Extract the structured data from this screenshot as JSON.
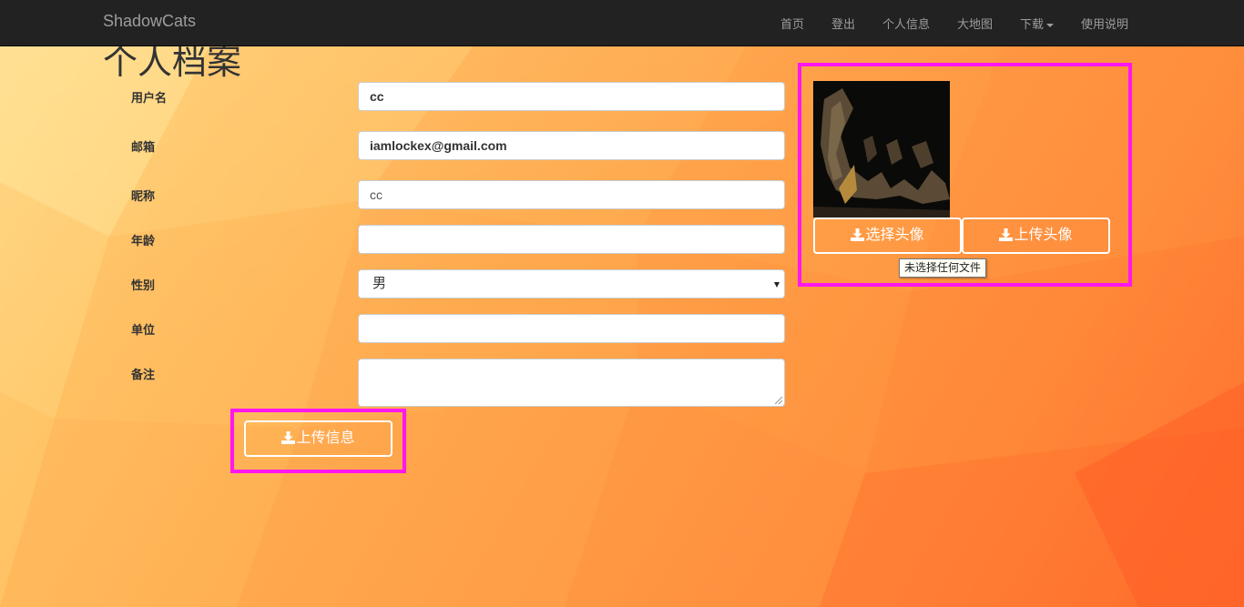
{
  "navbar": {
    "brand": "ShadowCats",
    "links": {
      "home": "首页",
      "logout": "登出",
      "profile": "个人信息",
      "map": "大地图",
      "download": "下载",
      "help": "使用说明"
    }
  },
  "page": {
    "title": "个人档案"
  },
  "form": {
    "username": {
      "label": "用户名",
      "value": "cc"
    },
    "email": {
      "label": "邮箱",
      "value": "iamlockex@gmail.com"
    },
    "nickname": {
      "label": "昵称",
      "value": "cc"
    },
    "age": {
      "label": "年龄",
      "value": ""
    },
    "gender": {
      "label": "性别",
      "value": "男"
    },
    "company": {
      "label": "单位",
      "value": ""
    },
    "remark": {
      "label": "备注",
      "value": ""
    },
    "submit_label": "上传信息"
  },
  "avatar_panel": {
    "choose_label": "选择头像",
    "upload_label": "上传头像",
    "tooltip": "未选择任何文件"
  },
  "icons": {
    "download": "download-icon",
    "caret": "caret-down-icon"
  },
  "colors": {
    "highlight": "#ff16f0",
    "navbar": "#222222",
    "nav_text": "#9d9d9d",
    "button_outline": "#ffffff"
  }
}
